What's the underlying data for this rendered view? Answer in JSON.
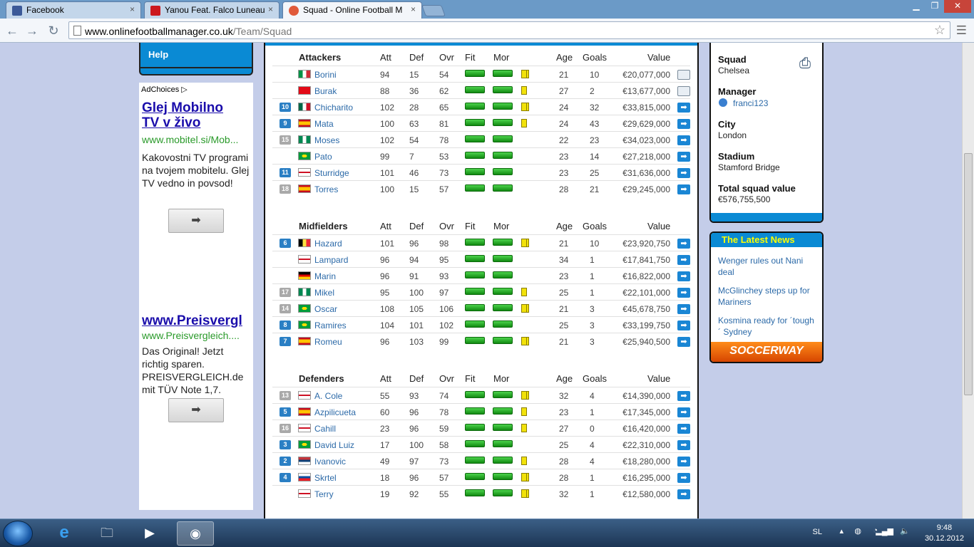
{
  "browser": {
    "tabs": [
      {
        "title": "Facebook",
        "icon": "facebook-icon",
        "color": "#3b5998"
      },
      {
        "title": "Yanou Feat. Falco Luneau",
        "icon": "youtube-icon",
        "color": "#cc181e"
      },
      {
        "title": "Squad - Online Football M",
        "icon": "ofm-icon",
        "color": "#e05a3a"
      }
    ],
    "url_host": "www.onlinefootballmanager.co.uk",
    "url_path": "/Team/Squad"
  },
  "sidebar": {
    "help": "Help"
  },
  "ad": {
    "choices": "AdChoices",
    "ad1": {
      "headline": "Glej Mobilno TV v živo",
      "url": "www.mobitel.si/Mob...",
      "text": "Kakovostni TV programi na tvojem mobitelu. Glej TV vedno in povsod!"
    },
    "ad2": {
      "headline": "www.Preisvergl",
      "url": "www.Preisvergleich....",
      "text": "Das Original! Jetzt richtig sparen. PREISVERGLEICH.de mit TÜV Note 1,7."
    }
  },
  "columns": {
    "att": "Att",
    "def": "Def",
    "ovr": "Ovr",
    "fit": "Fit",
    "mor": "Mor",
    "age": "Age",
    "goals": "Goals",
    "value": "Value"
  },
  "sections": [
    {
      "title": "Attackers",
      "players": [
        {
          "num": "",
          "flag": "italy",
          "name": "Borini",
          "att": "94",
          "def": "15",
          "ovr": "54",
          "card": "double",
          "age": "21",
          "goals": "10",
          "value": "€20,077,000",
          "action": "doc"
        },
        {
          "num": "",
          "flag": "turkey",
          "name": "Burak",
          "att": "88",
          "def": "36",
          "ovr": "62",
          "card": "single",
          "age": "27",
          "goals": "2",
          "value": "€13,677,000",
          "action": "doc"
        },
        {
          "num": "10",
          "numc": "b",
          "flag": "mexico",
          "name": "Chicharito",
          "att": "102",
          "def": "28",
          "ovr": "65",
          "card": "double",
          "age": "24",
          "goals": "32",
          "value": "€33,815,000",
          "action": "go"
        },
        {
          "num": "9",
          "numc": "b",
          "flag": "spain",
          "name": "Mata",
          "att": "100",
          "def": "63",
          "ovr": "81",
          "card": "single",
          "age": "24",
          "goals": "43",
          "value": "€29,629,000",
          "action": "go"
        },
        {
          "num": "15",
          "numc": "g",
          "flag": "nigeria",
          "name": "Moses",
          "att": "102",
          "def": "54",
          "ovr": "78",
          "card": "",
          "age": "22",
          "goals": "23",
          "value": "€34,023,000",
          "action": "go"
        },
        {
          "num": "",
          "flag": "brazil",
          "name": "Pato",
          "att": "99",
          "def": "7",
          "ovr": "53",
          "card": "",
          "age": "23",
          "goals": "14",
          "value": "€27,218,000",
          "action": "go"
        },
        {
          "num": "11",
          "numc": "b",
          "flag": "england",
          "name": "Sturridge",
          "att": "101",
          "def": "46",
          "ovr": "73",
          "card": "",
          "age": "23",
          "goals": "25",
          "value": "€31,636,000",
          "action": "go"
        },
        {
          "num": "18",
          "numc": "g",
          "flag": "spain",
          "name": "Torres",
          "att": "100",
          "def": "15",
          "ovr": "57",
          "card": "",
          "age": "28",
          "goals": "21",
          "value": "€29,245,000",
          "action": "go"
        }
      ]
    },
    {
      "title": "Midfielders",
      "players": [
        {
          "num": "6",
          "numc": "b",
          "flag": "belgium",
          "name": "Hazard",
          "att": "101",
          "def": "96",
          "ovr": "98",
          "card": "double",
          "age": "21",
          "goals": "10",
          "value": "€23,920,750",
          "action": "go"
        },
        {
          "num": "",
          "flag": "england",
          "name": "Lampard",
          "att": "96",
          "def": "94",
          "ovr": "95",
          "card": "",
          "age": "34",
          "goals": "1",
          "value": "€17,841,750",
          "action": "go"
        },
        {
          "num": "",
          "flag": "germany",
          "name": "Marin",
          "att": "96",
          "def": "91",
          "ovr": "93",
          "card": "",
          "age": "23",
          "goals": "1",
          "value": "€16,822,000",
          "action": "go"
        },
        {
          "num": "17",
          "numc": "g",
          "flag": "nigeria",
          "name": "Mikel",
          "att": "95",
          "def": "100",
          "ovr": "97",
          "card": "single",
          "age": "25",
          "goals": "1",
          "value": "€22,101,000",
          "action": "go"
        },
        {
          "num": "14",
          "numc": "g",
          "flag": "brazil",
          "name": "Oscar",
          "att": "108",
          "def": "105",
          "ovr": "106",
          "card": "double",
          "age": "21",
          "goals": "3",
          "value": "€45,678,750",
          "action": "go"
        },
        {
          "num": "8",
          "numc": "b",
          "flag": "brazil",
          "name": "Ramires",
          "att": "104",
          "def": "101",
          "ovr": "102",
          "card": "",
          "age": "25",
          "goals": "3",
          "value": "€33,199,750",
          "action": "go"
        },
        {
          "num": "7",
          "numc": "b",
          "flag": "spain",
          "name": "Romeu",
          "att": "96",
          "def": "103",
          "ovr": "99",
          "card": "double",
          "age": "21",
          "goals": "3",
          "value": "€25,940,500",
          "action": "go"
        }
      ]
    },
    {
      "title": "Defenders",
      "players": [
        {
          "num": "13",
          "numc": "g",
          "flag": "england",
          "name": "A. Cole",
          "att": "55",
          "def": "93",
          "ovr": "74",
          "card": "double",
          "age": "32",
          "goals": "4",
          "value": "€14,390,000",
          "action": "go"
        },
        {
          "num": "5",
          "numc": "b",
          "flag": "spain",
          "name": "Azpilicueta",
          "att": "60",
          "def": "96",
          "ovr": "78",
          "card": "single",
          "age": "23",
          "goals": "1",
          "value": "€17,345,000",
          "action": "go"
        },
        {
          "num": "16",
          "numc": "g",
          "flag": "england",
          "name": "Cahill",
          "att": "23",
          "def": "96",
          "ovr": "59",
          "card": "single",
          "age": "27",
          "goals": "0",
          "value": "€16,420,000",
          "action": "go"
        },
        {
          "num": "3",
          "numc": "b",
          "flag": "brazil",
          "name": "David Luiz",
          "att": "17",
          "def": "100",
          "ovr": "58",
          "card": "",
          "age": "25",
          "goals": "4",
          "value": "€22,310,000",
          "action": "go"
        },
        {
          "num": "2",
          "numc": "b",
          "flag": "serbia",
          "name": "Ivanovic",
          "att": "49",
          "def": "97",
          "ovr": "73",
          "card": "single",
          "age": "28",
          "goals": "4",
          "value": "€18,280,000",
          "action": "go"
        },
        {
          "num": "4",
          "numc": "b",
          "flag": "slovakia",
          "name": "Skrtel",
          "att": "18",
          "def": "96",
          "ovr": "57",
          "card": "double",
          "age": "28",
          "goals": "1",
          "value": "€16,295,000",
          "action": "go"
        },
        {
          "num": "",
          "flag": "england",
          "name": "Terry",
          "att": "19",
          "def": "92",
          "ovr": "55",
          "card": "double",
          "age": "32",
          "goals": "1",
          "value": "€12,580,000",
          "action": "go"
        }
      ]
    }
  ],
  "info": {
    "squad_label": "Squad",
    "squad": "Chelsea",
    "manager_label": "Manager",
    "manager": "franci123",
    "city_label": "City",
    "city": "London",
    "stadium_label": "Stadium",
    "stadium": "Stamford Bridge",
    "total_label": "Total squad value",
    "total": "€576,755,500"
  },
  "news": {
    "title": "The Latest News",
    "items": [
      "Wenger rules out Nani deal",
      "McGlinchey steps up for Mariners",
      "Kosmina ready for ´tough´ Sydney"
    ],
    "banner": "SOCCERWAY"
  },
  "taskbar": {
    "lang": "SL",
    "time": "9:48",
    "date": "30.12.2012"
  },
  "colors": {
    "accent": "#0a8ad4",
    "link": "#2c6aa8",
    "page_bg": "#c4cde9"
  }
}
